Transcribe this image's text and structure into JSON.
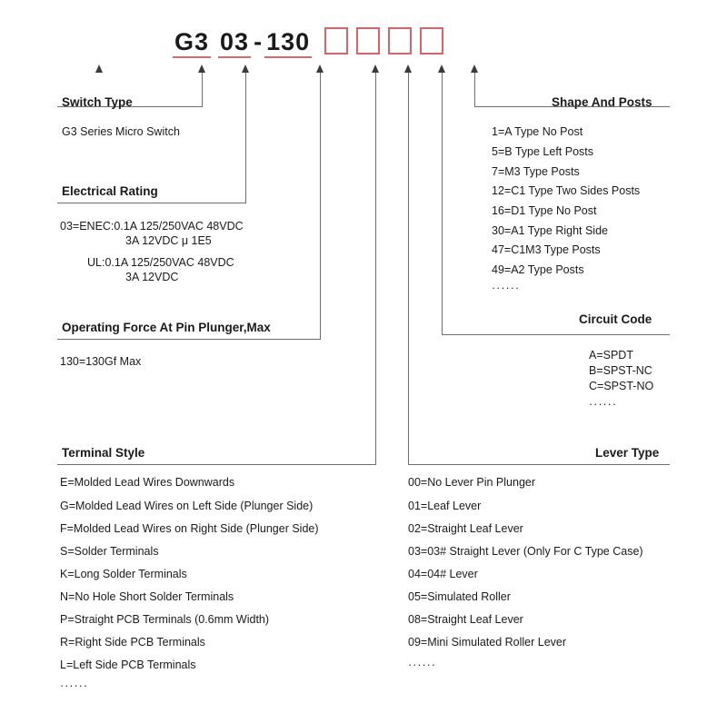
{
  "part_number": {
    "segments": [
      {
        "text": "G3",
        "underlined": true
      },
      {
        "text": "03",
        "underlined": true
      },
      {
        "text": "-",
        "underlined": false
      },
      {
        "text": "130",
        "underlined": true
      }
    ],
    "empty_boxes": 4,
    "box_border_color": "#d9636b",
    "underline_color": "#cf6b72"
  },
  "sections": {
    "switch_type": {
      "title": "Switch Type",
      "lines": [
        "G3 Series Micro Switch"
      ]
    },
    "electrical_rating": {
      "title": "Electrical Rating",
      "lines": [
        "03=ENEC:0.1A 125/250VAC 48VDC",
        "3A 12VDC  μ 1E5",
        "UL:0.1A 125/250VAC 48VDC",
        "3A 12VDC"
      ]
    },
    "operating_force": {
      "title": "Operating Force At Pin Plunger,Max",
      "lines": [
        "130=130Gf Max"
      ]
    },
    "terminal_style": {
      "title": "Terminal Style",
      "lines": [
        "E=Molded Lead Wires Downwards",
        "G=Molded Lead Wires on Left Side (Plunger Side)",
        "F=Molded Lead Wires on Right Side (Plunger Side)",
        "S=Solder Terminals",
        "K=Long Solder Terminals",
        "N=No Hole Short Solder Terminals",
        "P=Straight PCB Terminals (0.6mm Width)",
        "R=Right Side PCB Terminals",
        "L=Left Side PCB Terminals"
      ],
      "ellipsis": "······"
    },
    "shape_and_posts": {
      "title": "Shape And Posts",
      "lines": [
        "1=A Type No Post",
        "5=B Type Left Posts",
        "7=M3 Type Posts",
        "12=C1 Type Two Sides Posts",
        "16=D1 Type No Post",
        "30=A1 Type Right Side",
        "47=C1M3 Type Posts",
        "49=A2 Type Posts"
      ],
      "ellipsis": "······"
    },
    "circuit_code": {
      "title": "Circuit Code",
      "lines": [
        "A=SPDT",
        "B=SPST-NC",
        "C=SPST-NO"
      ],
      "ellipsis": "······"
    },
    "lever_type": {
      "title": "Lever Type",
      "lines": [
        "00=No Lever Pin Plunger",
        "01=Leaf Lever",
        "02=Straight Leaf Lever",
        "03=03# Straight Lever (Only For C Type Case)",
        "04=04# Lever",
        "05=Simulated Roller",
        "08=Straight Leaf Lever",
        "09=Mini Simulated Roller Lever"
      ],
      "ellipsis": "······"
    }
  }
}
